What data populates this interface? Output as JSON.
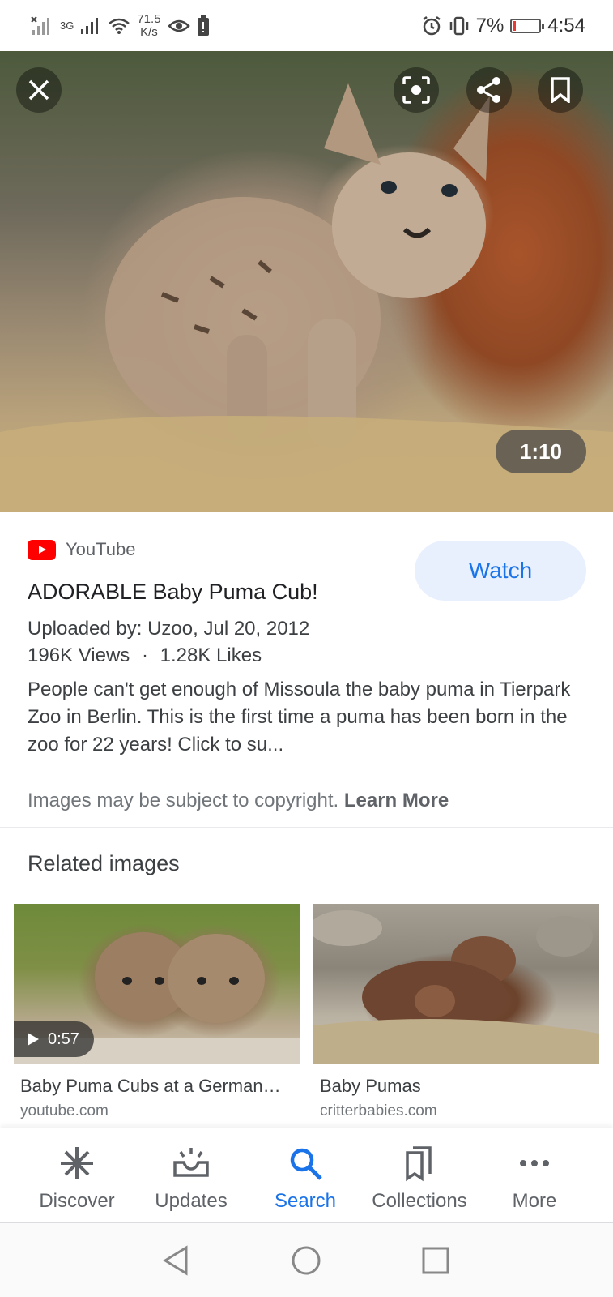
{
  "status_bar": {
    "network_type": "3G",
    "speed_value": "71.5",
    "speed_unit": "K/s",
    "battery_percent": "7%",
    "time": "4:54"
  },
  "hero": {
    "duration": "1:10"
  },
  "result": {
    "source_name": "YouTube",
    "watch_label": "Watch",
    "title": "ADORABLE Baby Puma Cub!",
    "uploaded": "Uploaded by: Uzoo, Jul 20, 2012",
    "views": "196K Views",
    "separator": "·",
    "likes": "1.28K Likes",
    "description": "People can't get enough of Missoula the baby puma in Tierpark Zoo in Berlin. This is the first time a puma has been born in the zoo for 22 years! Click to su...",
    "copyright_text": "Images may be subject to copyright.",
    "learn_more": "Learn More"
  },
  "related": {
    "heading": "Related images",
    "items": [
      {
        "title": "Baby Puma Cubs at a German…",
        "source": "youtube.com",
        "duration": "0:57"
      },
      {
        "title": "Baby Pumas",
        "source": "critterbabies.com"
      }
    ]
  },
  "bottom_nav": {
    "items": [
      {
        "label": "Discover",
        "icon": "asterisk-icon"
      },
      {
        "label": "Updates",
        "icon": "updates-icon"
      },
      {
        "label": "Search",
        "icon": "search-icon",
        "active": true
      },
      {
        "label": "Collections",
        "icon": "collections-icon"
      },
      {
        "label": "More",
        "icon": "more-dots-icon"
      }
    ]
  },
  "colors": {
    "accent": "#1a73e8",
    "watch_bg": "#e8f0fe",
    "youtube_red": "#ff0000",
    "battery_low": "#e53935"
  }
}
